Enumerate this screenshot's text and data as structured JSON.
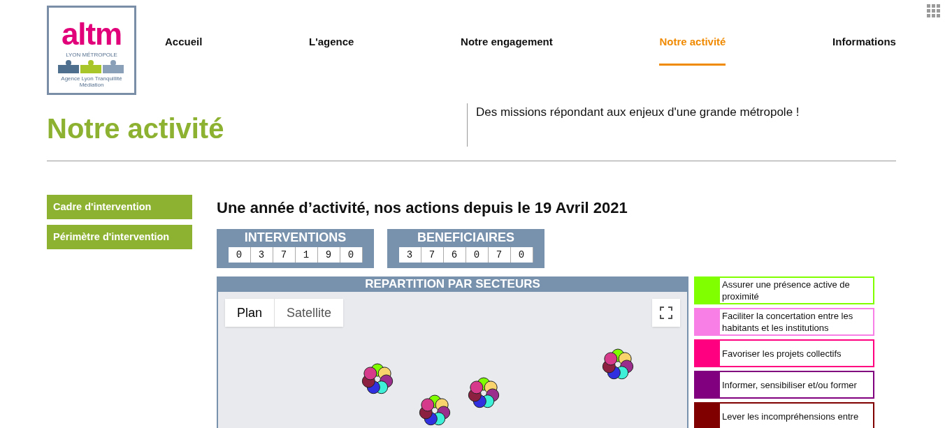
{
  "logo": {
    "wordmark": "altm",
    "region": "LYON MÉTROPOLE",
    "caption": "Agence Lyon Tranquillité Médiation"
  },
  "nav": [
    {
      "label": "Accueil",
      "selected": false
    },
    {
      "label": "L'agence",
      "selected": false
    },
    {
      "label": "Notre engagement",
      "selected": false
    },
    {
      "label": "Notre activité",
      "selected": true
    },
    {
      "label": "Informations",
      "selected": false
    }
  ],
  "page_title": "Notre activité",
  "tagline": "Des missions répondant aux enjeux d'une grande métropole !",
  "sidebar": [
    {
      "label": "Cadre d'intervention"
    },
    {
      "label": "Périmètre d'intervention"
    }
  ],
  "heading": "Une année d’activité, nos actions depuis le 19 Avril 2021",
  "counters": [
    {
      "title": "INTERVENTIONS",
      "digits": [
        "0",
        "3",
        "7",
        "1",
        "9",
        "0"
      ]
    },
    {
      "title": "BENEFICIAIRES",
      "digits": [
        "3",
        "7",
        "6",
        "0",
        "7",
        "0"
      ]
    }
  ],
  "map": {
    "title": "REPARTITION PAR SECTEURS",
    "map_types": [
      {
        "label": "Plan",
        "selected": true
      },
      {
        "label": "Satellite",
        "selected": false
      }
    ]
  },
  "legend": [
    {
      "label": "Assurer une présence active de proximité",
      "color": "#80ff00"
    },
    {
      "label": "Faciliter la concertation entre les habitants et les institutions",
      "color": "#f77fe6"
    },
    {
      "label": "Favoriser les projets collectifs",
      "color": "#ff0080"
    },
    {
      "label": "Informer, sensibiliser et/ou former",
      "color": "#800080"
    },
    {
      "label": "Lever les incompréhensions entre",
      "color": "#800000"
    }
  ]
}
